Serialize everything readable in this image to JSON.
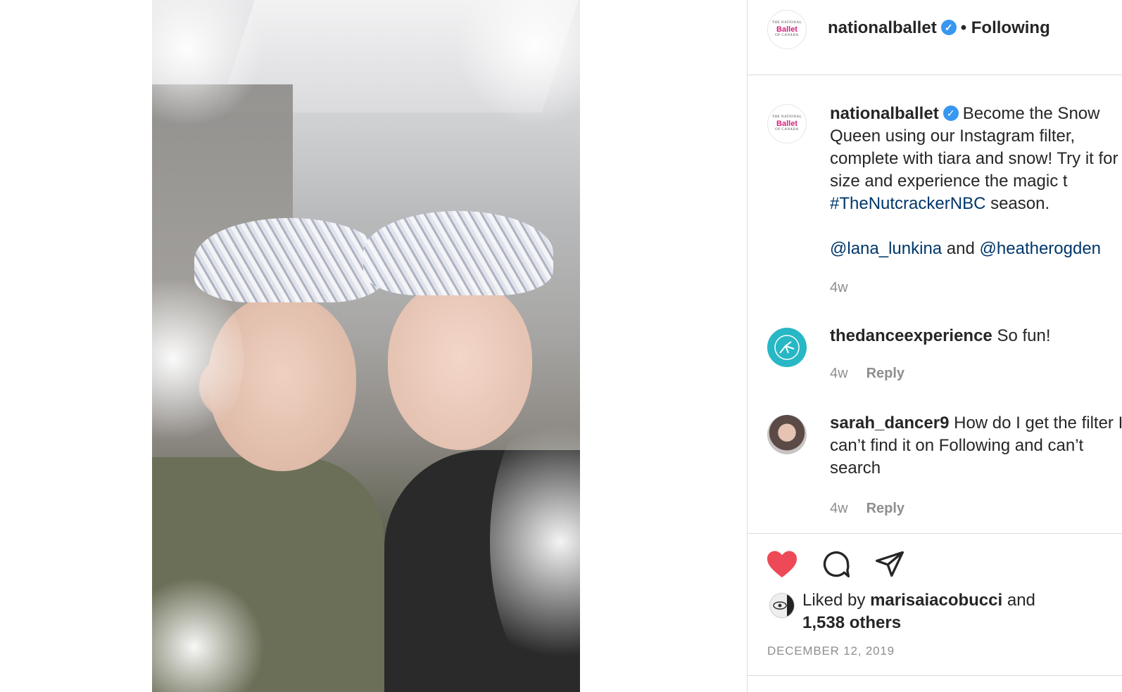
{
  "post": {
    "author": "nationalballet",
    "follow_status": "• Following",
    "avatar_text": {
      "line1": "THE NATIONAL",
      "line2": "Ballet",
      "line3": "OF CANADA"
    },
    "caption": {
      "user": "nationalballet",
      "text_1": "Become the Snow Queen using our Instagram filter, complete with tiara and snow! Try it for size and experience the magic t",
      "hashtag": "#TheNutcrackerNBC",
      "text_2": " season.",
      "mention_1": "@lana_lunkina",
      "and_text": " and ",
      "mention_2": "@heatherogden",
      "time": "4w"
    },
    "comments": [
      {
        "user": "thedanceexperience",
        "text": "So fun!",
        "time": "4w",
        "reply": "Reply"
      },
      {
        "user": "sarah_dancer9",
        "text": "How do I get the filter I can’t find it on Following and can’t search",
        "time": "4w",
        "reply": "Reply"
      }
    ],
    "likes": {
      "prefix": "Liked by ",
      "user": "marisaiacobucci",
      "mid": " and",
      "others": "1,538 others"
    },
    "date": "DECEMBER 12, 2019"
  },
  "colors": {
    "accent": "#3897f0",
    "like": "#ed4956",
    "link": "#00376b",
    "muted": "#8e8e8e"
  },
  "icons": [
    "verified-badge-icon",
    "heart-icon",
    "comment-icon",
    "share-icon"
  ]
}
